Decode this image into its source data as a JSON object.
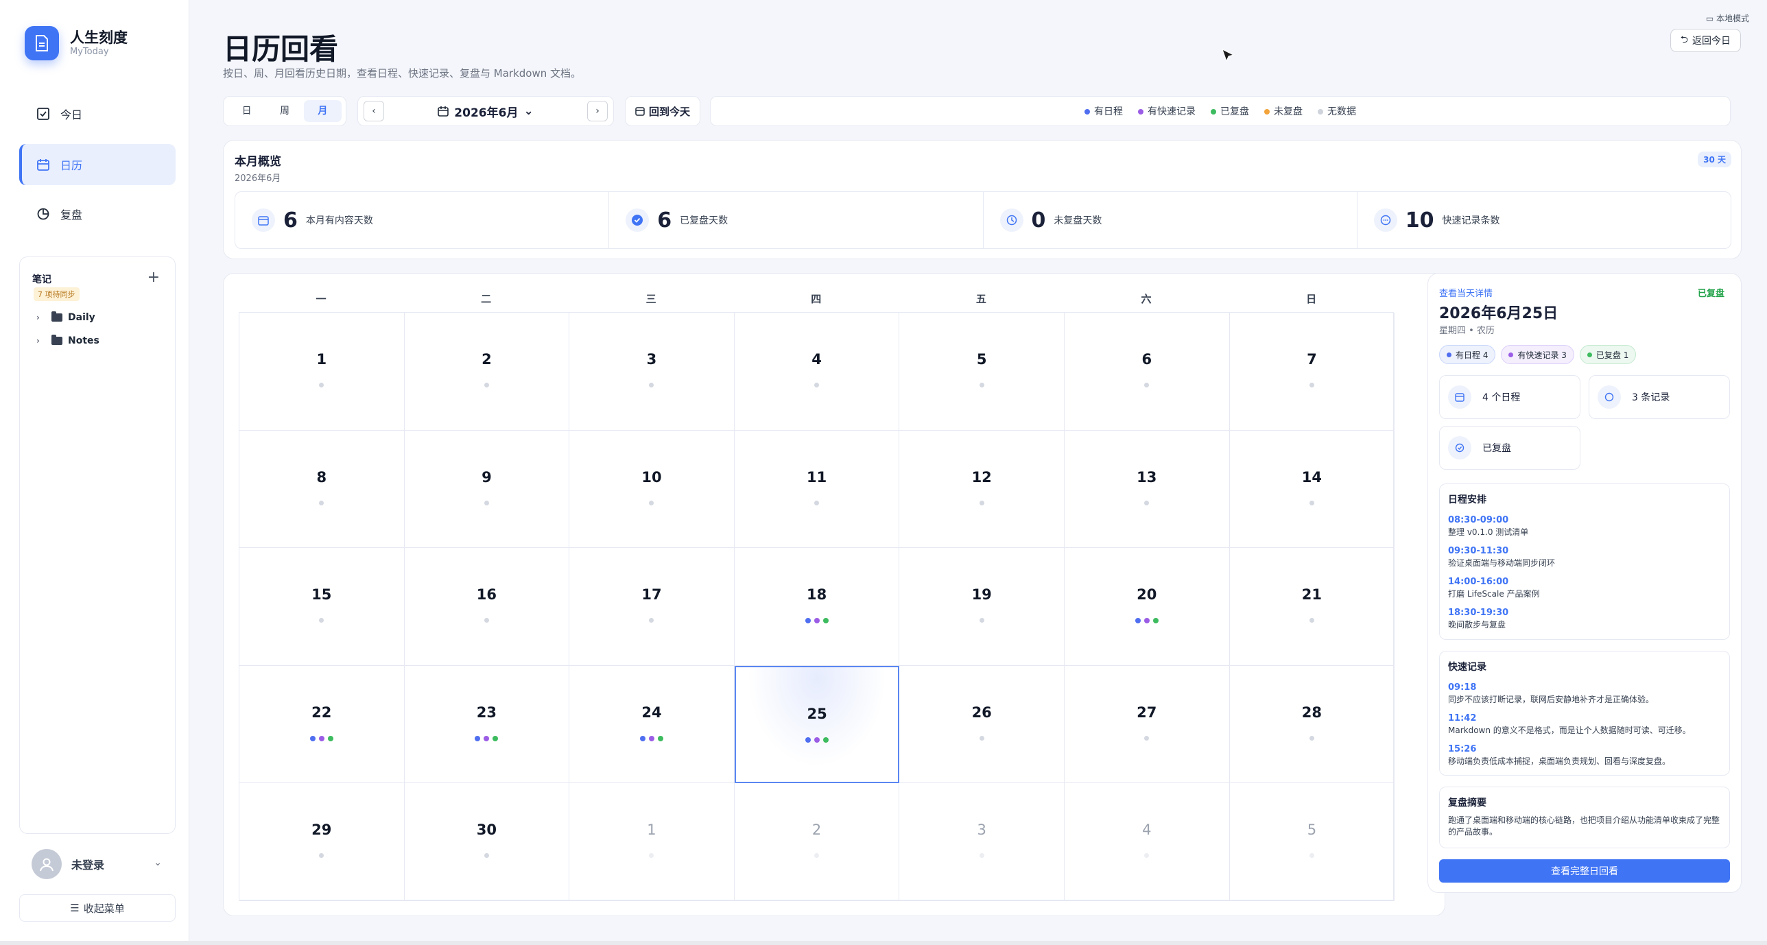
{
  "app": {
    "name": "人生刻度",
    "subtitle": "MyToday"
  },
  "sidebar": {
    "nav": [
      {
        "label": "今日",
        "icon": "checkbox-icon"
      },
      {
        "label": "日历",
        "icon": "calendar-icon"
      },
      {
        "label": "复盘",
        "icon": "pie-chart-icon"
      }
    ],
    "notes_title": "笔记",
    "sync_badge": "7 项待同步",
    "add": "+",
    "folders": [
      "Daily",
      "Notes"
    ],
    "user": "未登录",
    "collapse": "收起菜单"
  },
  "header": {
    "title": "日历回看",
    "subtitle": "按日、周、月回看历史日期，查看日程、快速记录、复盘与 Markdown 文档。",
    "mode": "本地模式",
    "back_today": "返回今日"
  },
  "toolbar": {
    "views": [
      "日",
      "周",
      "月"
    ],
    "active_view": "月",
    "month": "2026年6月",
    "goto_today": "回到今天",
    "legend": [
      {
        "label": "有日程",
        "color": "#4f6ef0"
      },
      {
        "label": "有快速记录",
        "color": "#9b5de5"
      },
      {
        "label": "已复盘",
        "color": "#3dbb5f"
      },
      {
        "label": "未复盘",
        "color": "#f2a33a"
      },
      {
        "label": "无数据",
        "color": "#cfd4dc"
      }
    ]
  },
  "overview": {
    "title": "本月概览",
    "subtitle": "2026年6月",
    "days_badge": "30 天",
    "stats": [
      {
        "value": "6",
        "label": "本月有内容天数",
        "icon": "calendar-icon"
      },
      {
        "value": "6",
        "label": "已复盘天数",
        "icon": "check-circle-icon"
      },
      {
        "value": "0",
        "label": "未复盘天数",
        "icon": "clock-icon"
      },
      {
        "value": "10",
        "label": "快速记录条数",
        "icon": "chat-icon"
      }
    ]
  },
  "calendar": {
    "weekdays": [
      "一",
      "二",
      "三",
      "四",
      "五",
      "六",
      "日"
    ],
    "days": [
      {
        "d": "1",
        "dots": []
      },
      {
        "d": "2",
        "dots": []
      },
      {
        "d": "3",
        "dots": []
      },
      {
        "d": "4",
        "dots": []
      },
      {
        "d": "5",
        "dots": []
      },
      {
        "d": "6",
        "dots": []
      },
      {
        "d": "7",
        "dots": []
      },
      {
        "d": "8",
        "dots": []
      },
      {
        "d": "9",
        "dots": []
      },
      {
        "d": "10",
        "dots": []
      },
      {
        "d": "11",
        "dots": []
      },
      {
        "d": "12",
        "dots": []
      },
      {
        "d": "13",
        "dots": []
      },
      {
        "d": "14",
        "dots": []
      },
      {
        "d": "15",
        "dots": []
      },
      {
        "d": "16",
        "dots": []
      },
      {
        "d": "17",
        "dots": []
      },
      {
        "d": "18",
        "dots": [
          "s",
          "q",
          "r"
        ]
      },
      {
        "d": "19",
        "dots": []
      },
      {
        "d": "20",
        "dots": [
          "s",
          "q",
          "r"
        ]
      },
      {
        "d": "21",
        "dots": []
      },
      {
        "d": "22",
        "dots": [
          "s",
          "q",
          "r"
        ]
      },
      {
        "d": "23",
        "dots": [
          "s",
          "q",
          "r"
        ]
      },
      {
        "d": "24",
        "dots": [
          "s",
          "q",
          "r"
        ]
      },
      {
        "d": "25",
        "dots": [
          "s",
          "q",
          "r"
        ],
        "selected": true
      },
      {
        "d": "26",
        "dots": []
      },
      {
        "d": "27",
        "dots": []
      },
      {
        "d": "28",
        "dots": []
      },
      {
        "d": "29",
        "dots": []
      },
      {
        "d": "30",
        "dots": []
      },
      {
        "d": "1",
        "dots": [],
        "other": true
      },
      {
        "d": "2",
        "dots": [],
        "other": true
      },
      {
        "d": "3",
        "dots": [],
        "other": true
      },
      {
        "d": "4",
        "dots": [],
        "other": true
      },
      {
        "d": "5",
        "dots": [],
        "other": true
      }
    ]
  },
  "detail": {
    "link": "查看当天详情",
    "status": "已复盘",
    "date": "2026年6月25日",
    "weekday": "星期四 • 农历",
    "chips": [
      {
        "label": "有日程 4",
        "color": "#4f6ef0",
        "kind": ""
      },
      {
        "label": "有快速记录 3",
        "color": "#9b5de5",
        "kind": "p"
      },
      {
        "label": "已复盘 1",
        "color": "#3dbb5f",
        "kind": "g"
      }
    ],
    "mini": [
      {
        "label": "4 个日程",
        "icon": "calendar-icon"
      },
      {
        "label": "3 条记录",
        "icon": "circle-icon"
      },
      {
        "label": "已复盘",
        "icon": "check-circle-icon"
      }
    ],
    "schedule_title": "日程安排",
    "schedule": [
      {
        "time": "08:30-09:00",
        "text": "整理 v0.1.0 测试清单"
      },
      {
        "time": "09:30-11:30",
        "text": "验证桌面端与移动端同步闭环"
      },
      {
        "time": "14:00-16:00",
        "text": "打磨 LifeScale 产品案例"
      },
      {
        "time": "18:30-19:30",
        "text": "晚间散步与复盘"
      }
    ],
    "quick_title": "快速记录",
    "quick": [
      {
        "time": "09:18",
        "text": "同步不应该打断记录，联网后安静地补齐才是正确体验。"
      },
      {
        "time": "11:42",
        "text": "Markdown 的意义不是格式，而是让个人数据随时可读、可迁移。"
      },
      {
        "time": "15:26",
        "text": "移动端负责低成本捕捉，桌面端负责规划、回看与深度复盘。"
      }
    ],
    "review_title": "复盘摘要",
    "review_text": "跑通了桌面端和移动端的核心链路，也把项目介绍从功能清单收束成了完整的产品故事。",
    "full_button": "查看完整日回看"
  }
}
